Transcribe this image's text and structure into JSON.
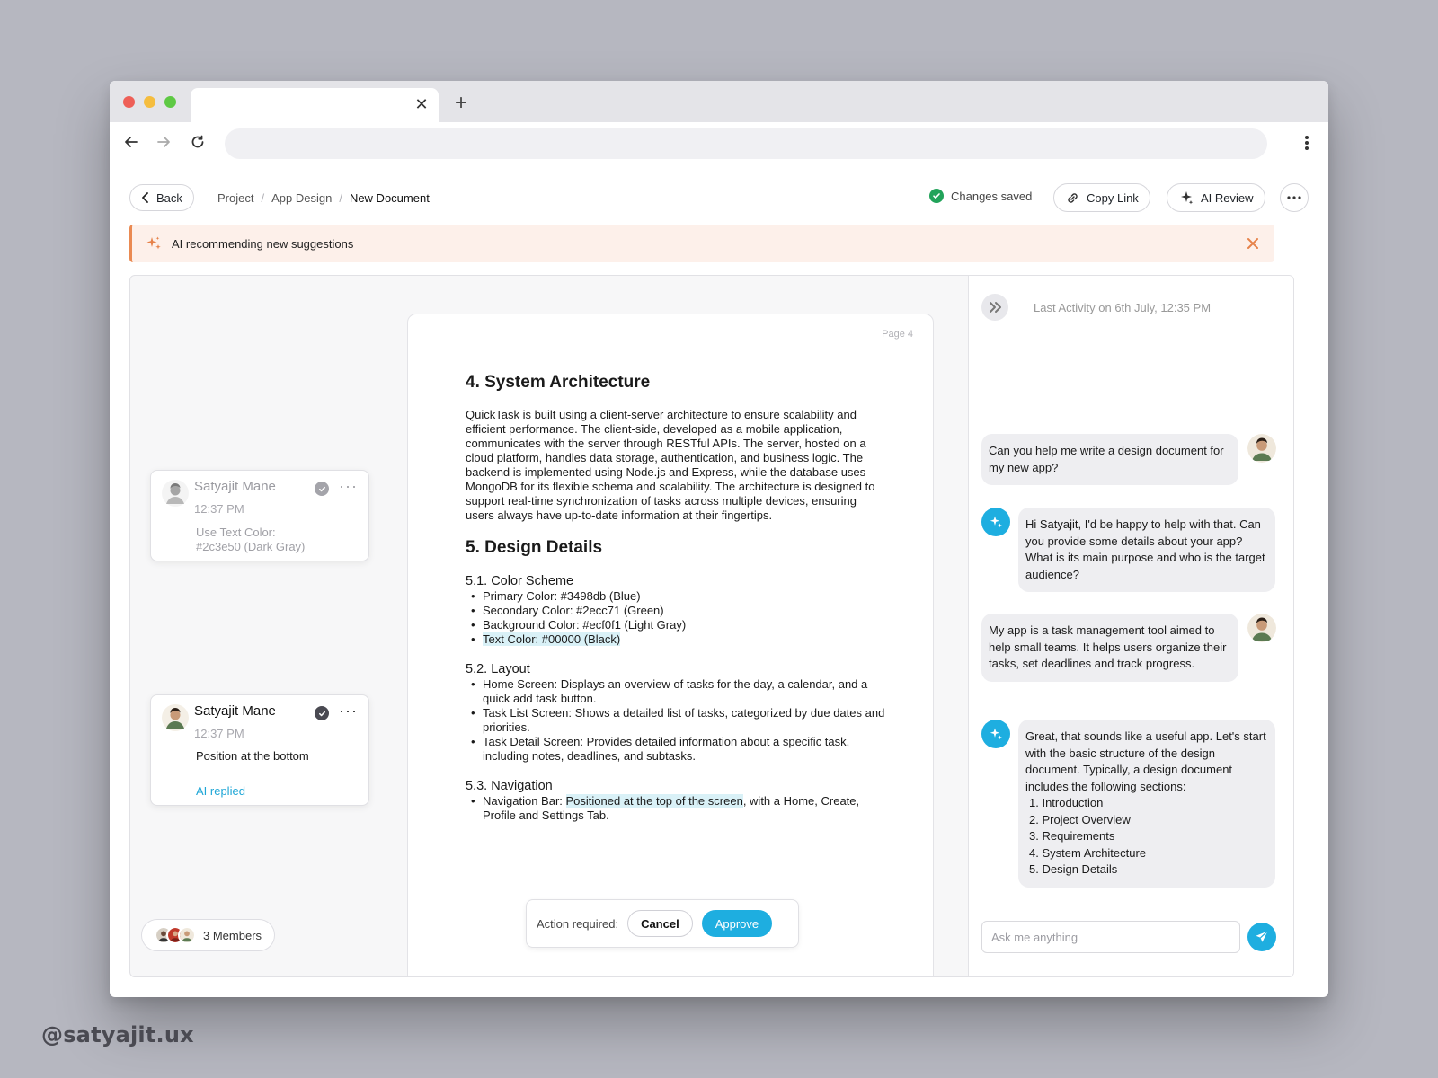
{
  "browser": {
    "tab_close": "✕",
    "tab_new": "+"
  },
  "header": {
    "back_label": "Back",
    "breadcrumb": [
      "Project",
      "App Design",
      "New Document"
    ],
    "breadcrumb_sep": "/",
    "saved_status": "Changes saved",
    "copy_link": "Copy Link",
    "ai_review": "AI Review"
  },
  "banner": {
    "text": "AI recommending new suggestions"
  },
  "document": {
    "page_label": "Page 4",
    "section4_title": "4. System Architecture",
    "section4_para": "QuickTask is built using a client-server architecture to ensure scalability and efficient performance. The client-side, developed as a mobile application, communicates with the server through RESTful APIs. The server, hosted on a cloud platform, handles data storage, authentication, and business logic. The backend is implemented using Node.js and Express, while the database uses MongoDB for its flexible schema and scalability. The architecture is designed to support real-time synchronization of tasks across multiple devices, ensuring users always have up-to-date information at their fingertips.",
    "section5_title": "5. Design Details",
    "s51_title": "5.1. Color Scheme",
    "s51_items": [
      "Primary Color: #3498db (Blue)",
      "Secondary Color: #2ecc71 (Green)",
      "Background Color: #ecf0f1 (Light Gray)",
      "Text Color: #00000 (Black)"
    ],
    "s52_title": "5.2. Layout",
    "s52_items": [
      "Home Screen: Displays an overview of tasks for the day, a calendar, and a quick add task button.",
      "Task List Screen: Shows a detailed list of tasks, categorized by due dates and priorities.",
      "Task Detail Screen: Provides detailed information about a specific task, including notes, deadlines, and subtasks."
    ],
    "s53_title": "5.3. Navigation",
    "s53_prefix": "Navigation Bar: ",
    "s53_highlight": "Positioned at the top of the screen",
    "s53_suffix": ", with a Home, Create, Profile and Settings Tab."
  },
  "action_bar": {
    "label": "Action required:",
    "cancel": "Cancel",
    "approve": "Approve"
  },
  "comments": [
    {
      "name": "Satyajit Mane",
      "time": "12:37 PM",
      "text_line1": "Use Text Color:",
      "text_line2": "#2c3e50 (Dark Gray)"
    },
    {
      "name": "Satyajit Mane",
      "time": "12:37 PM",
      "text": "Position at the bottom",
      "reply": "AI replied"
    }
  ],
  "members": {
    "label": "3 Members"
  },
  "chat": {
    "last_activity": "Last Activity on 6th July, 12:35 PM",
    "messages": [
      {
        "role": "user",
        "text": "Can you help me write a design document for my new app?"
      },
      {
        "role": "ai",
        "text": "Hi Satyajit, I'd be happy to help with that. Can you provide some details about your app? What is its main purpose and who is the target audience?"
      },
      {
        "role": "user",
        "text": "My app is a task management tool aimed to help small teams. It helps users organize their tasks, set deadlines and track progress."
      },
      {
        "role": "ai",
        "text": "Great, that sounds like a useful app. Let's start with the basic structure of the design document. Typically, a design document includes the following sections:",
        "list": [
          "1. Introduction",
          "2. Project Overview",
          "3. Requirements",
          "4. System Architecture",
          "5. Design Details"
        ]
      }
    ],
    "input_placeholder": "Ask me anything"
  },
  "watermark": "@satyajit.ux",
  "colors": {
    "accent": "#1eaee0",
    "banner_bg": "#fdf0ea",
    "banner_accent": "#ea8a52",
    "success": "#22a35a"
  }
}
